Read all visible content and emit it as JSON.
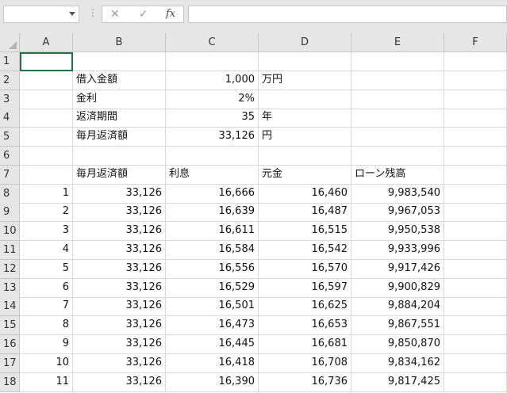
{
  "formula_bar": {
    "name_box_value": "",
    "cancel_icon": "cancel-x-icon",
    "enter_icon": "check-icon",
    "fx_label": "fx",
    "formula_value": ""
  },
  "columns": [
    "A",
    "B",
    "C",
    "D",
    "E",
    "F"
  ],
  "rows": [
    {
      "num": "1",
      "cells": [
        "",
        "",
        "",
        "",
        "",
        ""
      ]
    },
    {
      "num": "2",
      "cells": [
        "",
        "借入金額",
        "1,000",
        "万円",
        "",
        ""
      ]
    },
    {
      "num": "3",
      "cells": [
        "",
        "金利",
        "2%",
        "",
        "",
        ""
      ]
    },
    {
      "num": "4",
      "cells": [
        "",
        "返済期間",
        "35",
        "年",
        "",
        ""
      ]
    },
    {
      "num": "5",
      "cells": [
        "",
        "毎月返済額",
        "33,126",
        "円",
        "",
        ""
      ]
    },
    {
      "num": "6",
      "cells": [
        "",
        "",
        "",
        "",
        "",
        ""
      ]
    },
    {
      "num": "7",
      "cells": [
        "",
        "毎月返済額",
        "利息",
        "元金",
        "ローン残高",
        ""
      ]
    },
    {
      "num": "8",
      "cells": [
        "1",
        "33,126",
        "16,666",
        "16,460",
        "9,983,540",
        ""
      ]
    },
    {
      "num": "9",
      "cells": [
        "2",
        "33,126",
        "16,639",
        "16,487",
        "9,967,053",
        ""
      ]
    },
    {
      "num": "10",
      "cells": [
        "3",
        "33,126",
        "16,611",
        "16,515",
        "9,950,538",
        ""
      ]
    },
    {
      "num": "11",
      "cells": [
        "4",
        "33,126",
        "16,584",
        "16,542",
        "9,933,996",
        ""
      ]
    },
    {
      "num": "12",
      "cells": [
        "5",
        "33,126",
        "16,556",
        "16,570",
        "9,917,426",
        ""
      ]
    },
    {
      "num": "13",
      "cells": [
        "6",
        "33,126",
        "16,529",
        "16,597",
        "9,900,829",
        ""
      ]
    },
    {
      "num": "14",
      "cells": [
        "7",
        "33,126",
        "16,501",
        "16,625",
        "9,884,204",
        ""
      ]
    },
    {
      "num": "15",
      "cells": [
        "8",
        "33,126",
        "16,473",
        "16,653",
        "9,867,551",
        ""
      ]
    },
    {
      "num": "16",
      "cells": [
        "9",
        "33,126",
        "16,445",
        "16,681",
        "9,850,870",
        ""
      ]
    },
    {
      "num": "17",
      "cells": [
        "10",
        "33,126",
        "16,418",
        "16,708",
        "9,834,162",
        ""
      ]
    },
    {
      "num": "18",
      "cells": [
        "11",
        "33,126",
        "16,390",
        "16,736",
        "9,817,425",
        ""
      ]
    }
  ]
}
